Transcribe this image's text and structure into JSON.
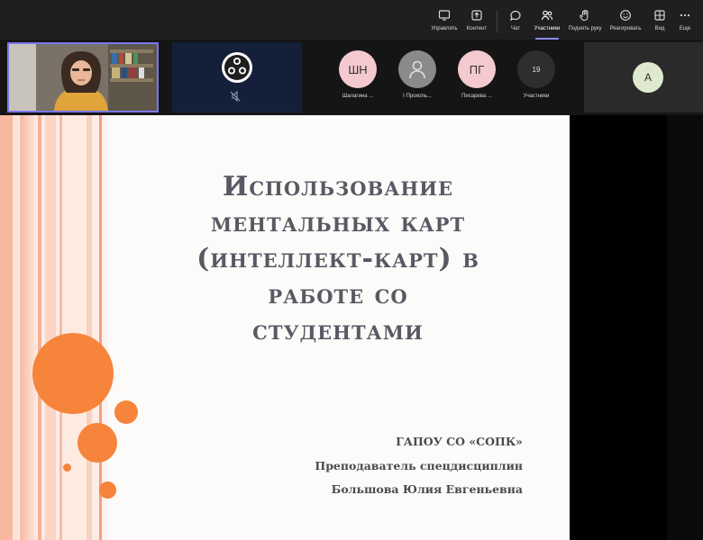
{
  "toolbar": {
    "items": [
      {
        "label": "Управлять",
        "icon": "present-icon"
      },
      {
        "label": "Контент",
        "icon": "share-content-icon"
      },
      {
        "label": "Чат",
        "icon": "chat-icon"
      },
      {
        "label": "Участники",
        "icon": "people-icon"
      },
      {
        "label": "Поднять руку",
        "icon": "raise-hand-icon"
      },
      {
        "label": "Реагировать",
        "icon": "react-icon"
      },
      {
        "label": "Вид",
        "icon": "view-grid-icon"
      },
      {
        "label": "Еще",
        "icon": "more-icon"
      }
    ],
    "accent": "#8b8cf0"
  },
  "participants": [
    {
      "initials": "ШН",
      "name": "Шалагина ...",
      "color": "#f4c9cf"
    },
    {
      "initials": "",
      "name": "I Прокопь...",
      "color": "#8a8a8a"
    },
    {
      "initials": "ПГ",
      "name": "Писарева ...",
      "color": "#f4c9cf"
    },
    {
      "initials": "19",
      "name": "Участники",
      "color": "#2e2e2e"
    }
  ],
  "side_tile": {
    "initials": "A"
  },
  "slide": {
    "title_lines": [
      "Использование",
      "ментальных карт",
      "(интеллект-карт) в",
      "работе со",
      "студентами"
    ],
    "org": "ГАПОУ СО «СОПК»",
    "teacher_role": "Преподаватель спецдисциплин",
    "teacher_name": "Большова Юлия Евгеньевна",
    "accent": "#f6843a"
  }
}
